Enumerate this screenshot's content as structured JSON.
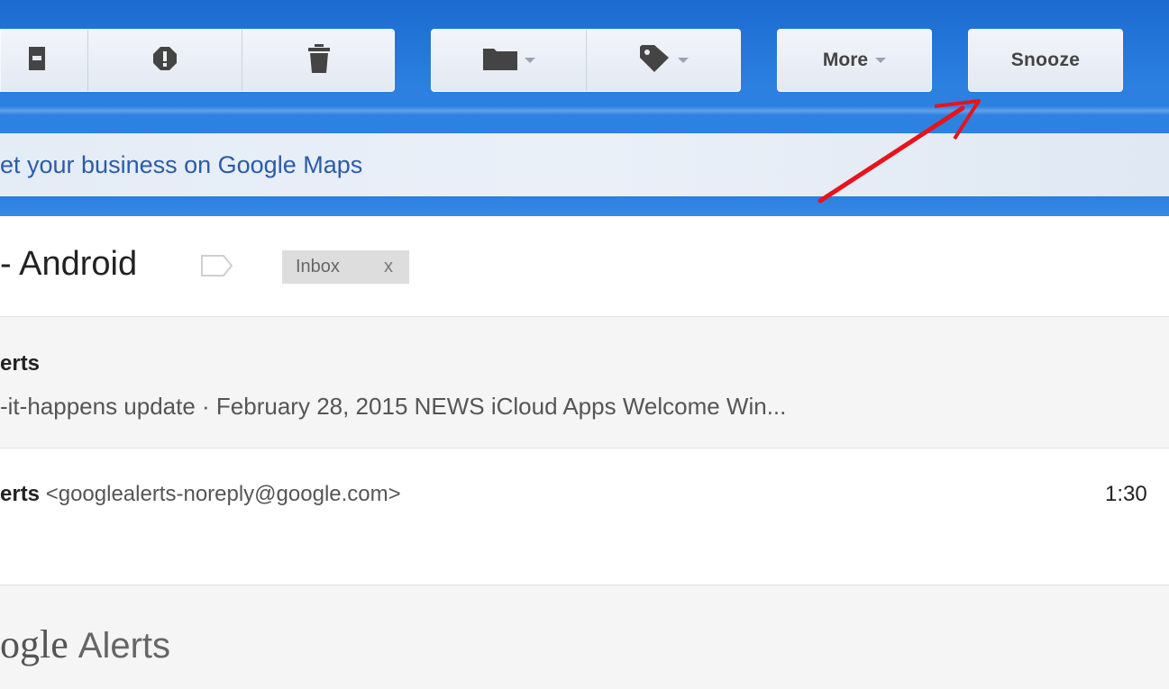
{
  "toolbar": {
    "archive_icon": "archive-icon",
    "spam_icon": "report-spam-icon",
    "delete_icon": "trash-icon",
    "move_icon": "folder-icon",
    "labels_icon": "label-tag-icon",
    "more_label": "More",
    "snooze_label": "Snooze"
  },
  "promo": {
    "text": "et your business on Google Maps"
  },
  "thread": {
    "subject": "- Android",
    "label_chip": "Inbox",
    "label_chip_remove": "x"
  },
  "messages": [
    {
      "sender": "erts",
      "snippet": "-it-happens update · February 28, 2015 NEWS iCloud Apps Welcome Win..."
    },
    {
      "sender": "erts",
      "email": "<googlealerts-noreply@google.com>",
      "time": "1:30"
    }
  ],
  "body": {
    "logo_part1": "ogle",
    "logo_part2": "Alerts"
  },
  "colors": {
    "header_blue": "#2b80e0",
    "button_bg": "#e9eef5",
    "link_blue": "#2b5ba8",
    "annotation_red": "#e8131b"
  }
}
